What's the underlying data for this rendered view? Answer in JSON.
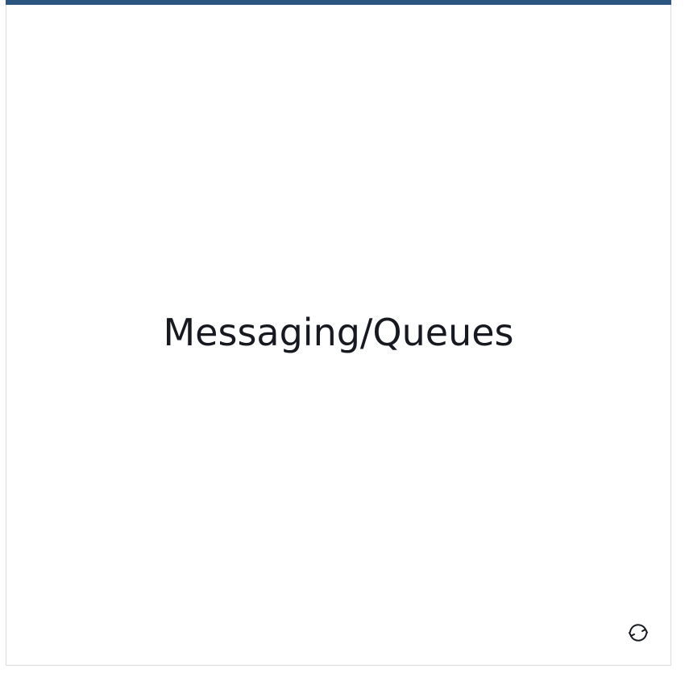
{
  "card": {
    "title": "Messaging/Queues",
    "accent_color": "#2a5681",
    "refresh_icon": "refresh-icon"
  }
}
